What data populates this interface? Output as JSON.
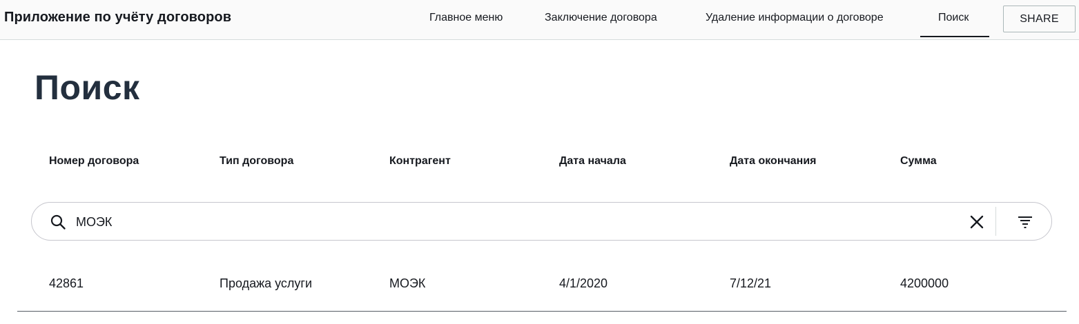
{
  "app": {
    "title": "Приложение по учёту договоров"
  },
  "nav": {
    "items": [
      {
        "label": "Главное меню"
      },
      {
        "label": "Заключение договора"
      },
      {
        "label": "Удаление информации о договоре"
      },
      {
        "label": "Поиск",
        "active": true
      }
    ],
    "share_label": "SHARE"
  },
  "page": {
    "heading": "Поиск"
  },
  "table": {
    "columns": [
      "Номер договора",
      "Тип договора",
      "Контрагент",
      "Дата начала",
      "Дата окончания",
      "Сумма"
    ],
    "rows": [
      [
        "42861",
        "Продажа услуги",
        "МОЭК",
        "4/1/2020",
        "7/12/21",
        "4200000"
      ]
    ]
  },
  "search": {
    "value": "МОЭК",
    "icons": {
      "search": "search-icon",
      "clear": "close-icon",
      "filter": "filter-icon"
    }
  },
  "colors": {
    "heading": "#232f3e",
    "text": "#16191f",
    "topbar_bg": "#fafafa",
    "search_border": "#c6c6cd"
  }
}
